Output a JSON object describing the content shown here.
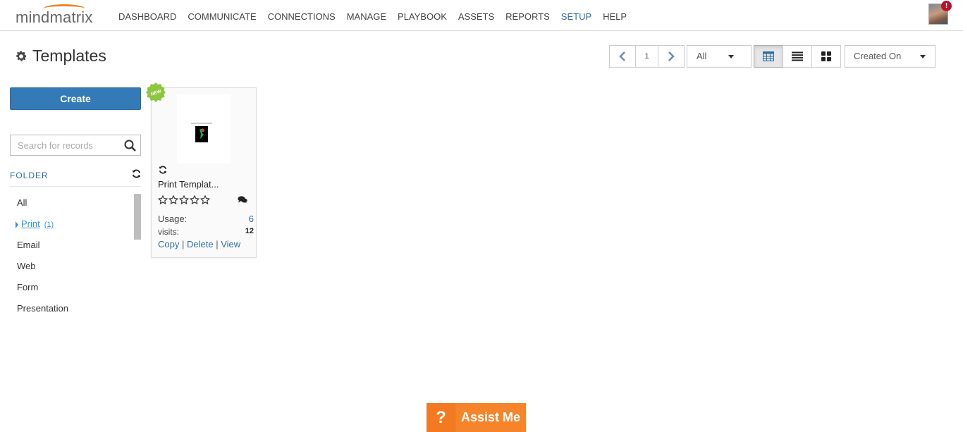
{
  "header": {
    "logo_text": "mindmatrix",
    "nav": [
      {
        "label": "DASHBOARD",
        "active": false
      },
      {
        "label": "COMMUNICATE",
        "active": false
      },
      {
        "label": "CONNECTIONS",
        "active": false
      },
      {
        "label": "MANAGE",
        "active": false
      },
      {
        "label": "PLAYBOOK",
        "active": false
      },
      {
        "label": "ASSETS",
        "active": false
      },
      {
        "label": "REPORTS",
        "active": false
      },
      {
        "label": "SETUP",
        "active": true
      },
      {
        "label": "HELP",
        "active": false
      }
    ],
    "notification_badge": "!"
  },
  "page": {
    "title": "Templates",
    "icon": "gear-icon"
  },
  "toolbar": {
    "page_number": "1",
    "filter_value": "All",
    "sort_value": "Created On",
    "active_view": "grid"
  },
  "sidebar": {
    "create_label": "Create",
    "search_placeholder": "Search for records",
    "folder_label": "FOLDER",
    "folders": [
      {
        "label": "All",
        "count": "",
        "active": false
      },
      {
        "label": "Print",
        "count": "(1)",
        "active": true
      },
      {
        "label": "Email",
        "count": "",
        "active": false
      },
      {
        "label": "Web",
        "count": "",
        "active": false
      },
      {
        "label": "Form",
        "count": "",
        "active": false
      },
      {
        "label": "Presentation",
        "count": "",
        "active": false
      }
    ]
  },
  "card": {
    "badge": "NEW",
    "title": "Print Templat...",
    "rating": 0,
    "rating_max": 5,
    "usage_label": "Usage:",
    "usage_value": "6",
    "visits_label": "visits:",
    "visits_value": "12",
    "actions": [
      "Copy",
      "Delete",
      "View"
    ]
  },
  "assist": {
    "icon_text": "?",
    "label": "Assist Me"
  },
  "colors": {
    "brand_blue": "#337ab7",
    "link_blue": "#2e6da4",
    "logo_orange": "#e58a2b",
    "assist_orange": "#f5842a",
    "badge_green": "#8dc63f",
    "alert_red": "#b3162c"
  }
}
